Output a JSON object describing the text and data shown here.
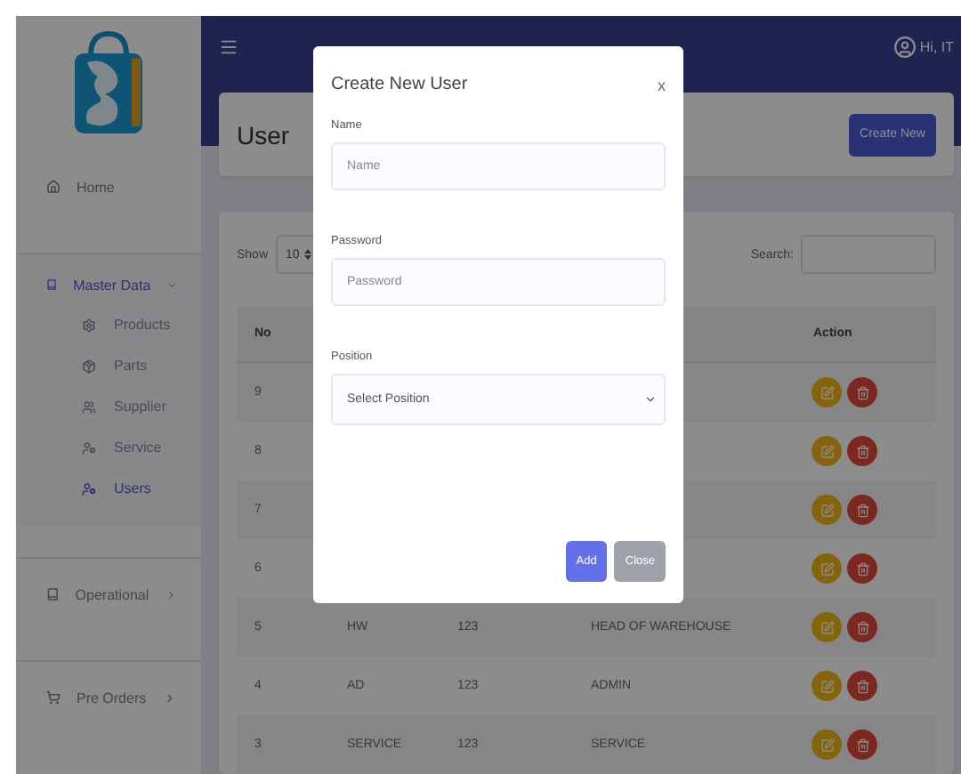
{
  "sidebar": {
    "items": [
      {
        "label": "Home",
        "selected": false
      },
      {
        "label": "Master Data",
        "selected": true,
        "expanded": true,
        "children": [
          {
            "label": "Products",
            "selected": false
          },
          {
            "label": "Parts",
            "selected": false
          },
          {
            "label": "Supplier",
            "selected": false
          },
          {
            "label": "Service",
            "selected": false
          },
          {
            "label": "Users",
            "selected": true
          }
        ]
      },
      {
        "label": "Operational",
        "selected": false,
        "expanded": false
      },
      {
        "label": "Pre Orders",
        "selected": false,
        "expanded": false
      }
    ]
  },
  "topbar": {
    "user": "Hi, IT"
  },
  "page": {
    "title": "User",
    "create_button": "Create New"
  },
  "table": {
    "show_label": "Show",
    "page_size": "10",
    "search_label": "Search:",
    "columns": [
      "No",
      "Action"
    ],
    "rows": [
      {
        "no": "9"
      },
      {
        "no": "8"
      },
      {
        "no": "7"
      },
      {
        "no": "6"
      },
      {
        "no": "5",
        "cells": [
          "HW",
          "123",
          "HEAD OF WAREHOUSE"
        ]
      },
      {
        "no": "4",
        "cells": [
          "AD",
          "123",
          "ADMIN"
        ]
      },
      {
        "no": "3",
        "cells": [
          "SERVICE",
          "123",
          "SERVICE"
        ]
      }
    ]
  },
  "modal": {
    "title": "Create New User",
    "close": "x",
    "fields": [
      {
        "kind": "text",
        "label": "Name",
        "placeholder": "Name"
      },
      {
        "kind": "text",
        "label": "Password",
        "placeholder": "Password"
      },
      {
        "kind": "select",
        "label": "Position",
        "value": "Select Position"
      }
    ],
    "buttons": [
      {
        "label": "Add",
        "kind": "primary"
      },
      {
        "label": "Close",
        "kind": "secondary"
      }
    ]
  }
}
